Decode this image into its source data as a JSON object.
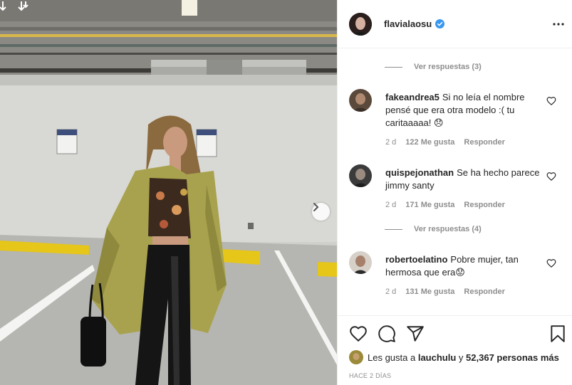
{
  "colors": {
    "border": "#efefef",
    "text": "#262626",
    "muted": "#8e8e8e",
    "verified": "#3897f0",
    "jacket": "#a8a24e",
    "parking_yellow": "#e6c619"
  },
  "post": {
    "author": "flavialaosu",
    "verified": true,
    "more_icon": "more-horizontal-icon",
    "media_icons": [
      "carousel-multi-icon",
      "chevron-right-icon"
    ]
  },
  "comments": [
    {
      "type": "view_replies",
      "label": "Ver respuestas (3)"
    },
    {
      "type": "comment",
      "username": "fakeandrea5",
      "text": "Si no leía el nombre pensé que era otra modelo :( tu caritaaaaa! 😞",
      "age": "2 d",
      "likes": "122 Me gusta",
      "reply": "Responder"
    },
    {
      "type": "comment",
      "username": "quispejonathan",
      "text": "Se ha hecho parece jimmy santy",
      "age": "2 d",
      "likes": "171 Me gusta",
      "reply": "Responder"
    },
    {
      "type": "view_replies",
      "label": "Ver respuestas (4)"
    },
    {
      "type": "comment",
      "username": "robertoelatino",
      "text": "Pobre mujer, tan hermosa que era😟",
      "age": "2 d",
      "likes": "131 Me gusta",
      "reply": "Responder"
    }
  ],
  "actions": {
    "icons": [
      "heart-icon",
      "comment-icon",
      "share-icon",
      "bookmark-icon"
    ]
  },
  "likes": {
    "prefix": "Les gusta a",
    "user": "lauchulu",
    "joiner": "y",
    "others": "52,367 personas más"
  },
  "timestamp": "HACE 2 DÍAS"
}
